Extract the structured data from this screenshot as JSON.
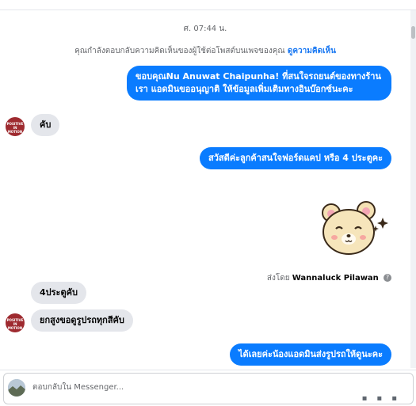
{
  "thread": {
    "timestamp": "ศ. 07:44 น.",
    "context_note": "คุณกำลังตอบกลับความคิดเห็นของผู้ใช้ต่อโพสต์บนเพจของคุณ",
    "context_link": "ดูความคิดเห็น",
    "messages": [
      {
        "side": "out",
        "text": "ขอบคุณNu Anuwat Chaipunha! ที่สนใจรถยนต์ของทางร้านเรา แอดมินขออนุญาติ ให้ข้อมูลเพิ่มเติมทางอินบ๊อกซ์นะคะ"
      },
      {
        "side": "in",
        "text": "คับ"
      },
      {
        "side": "out",
        "text": "สวัสดีค่ะลูกค้าสนใจฟอร์ดแคป หรือ 4  ประตูคะ"
      },
      {
        "side": "in",
        "text": "4ประตูคับ"
      },
      {
        "side": "in",
        "text": "ยกสูงขอดูรูปรถทุกสีคับ"
      },
      {
        "side": "out",
        "text": "ได้เลยค่ะน้องแอดมินส่งรูปรถให้ดูนะคะ"
      }
    ],
    "sent_by_prefix": "ส่งโดย",
    "sent_by_name": "Wannaluck Pilawan",
    "avatar_text": "POSITIVE IN MOTION"
  },
  "composer": {
    "placeholder": "ตอบกลับใน Messenger..."
  },
  "colors": {
    "outgoing_bubble": "#0a7cff",
    "incoming_bubble": "#e4e6eb",
    "link": "#1877f2"
  }
}
